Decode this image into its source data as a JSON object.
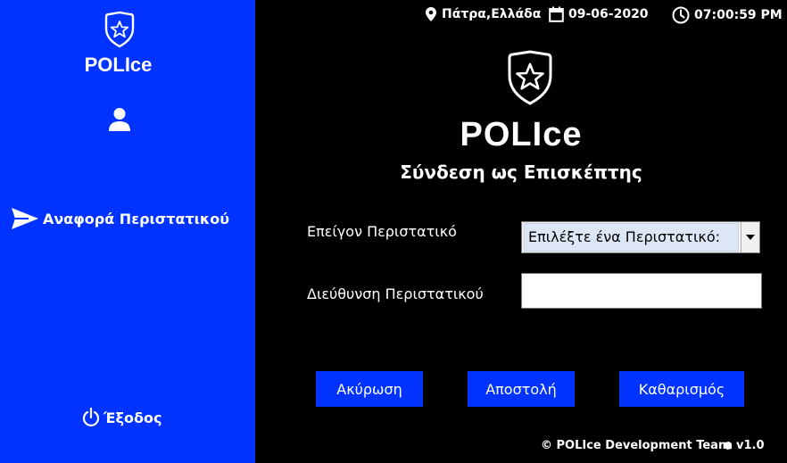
{
  "sidebar": {
    "brand": "POLIce",
    "report_label": "Αναφορά Περιστατικού",
    "exit_label": "Έξοδος",
    "icons": [
      "badge-icon",
      "user-icon",
      "send-icon",
      "power-icon"
    ]
  },
  "topbar": {
    "location": "Πάτρα,Ελλάδα",
    "date": "09-06-2020",
    "time": "07:00:59 PM"
  },
  "main": {
    "brand": "POLIce",
    "subtitle": "Σύνδεση ως Επισκέπτης",
    "incident_label": "Επείγον Περιστατικό",
    "incident_select_value": "Επιλέξτε ένα Περιστατικό:",
    "address_label": "Διεύθυνση Περιστατικού",
    "address_value": "",
    "buttons": {
      "cancel": "Ακύρωση",
      "submit": "Αποστολή",
      "clear": "Καθαρισμός"
    }
  },
  "footer": {
    "copyright": "© POLIce Development Team",
    "version": "v1.0"
  },
  "colors": {
    "sidebar_bg": "#0033ff",
    "main_bg": "#000000",
    "button_bg": "#0033ff",
    "text": "#ffffff"
  }
}
